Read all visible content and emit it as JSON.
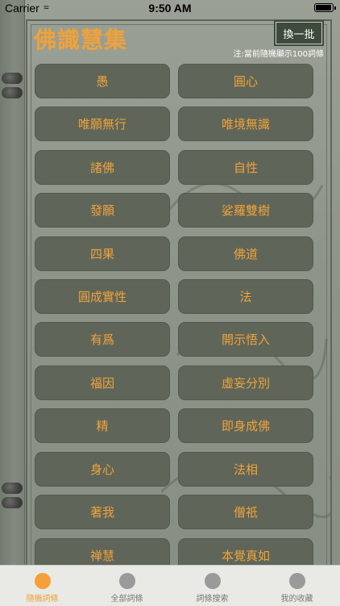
{
  "status_bar": {
    "carrier": "Carrier",
    "time": "9:50 AM"
  },
  "header": {
    "title": "佛識慧集",
    "refresh_label": "換一批",
    "note": "注:當前隨機顯示100詞條"
  },
  "words": [
    "愚",
    "圓心",
    "唯願無行",
    "唯境無識",
    "諸佛",
    "自性",
    "發願",
    "娑羅雙樹",
    "四果",
    "佛道",
    "圓成實性",
    "法",
    "有爲",
    "開示悟入",
    "福因",
    "虛妄分別",
    "精",
    "即身成佛",
    "身心",
    "法相",
    "著我",
    "僧祇",
    "禅慧",
    "本覺真如"
  ],
  "tabs": [
    {
      "label": "隨機詞條",
      "active": true,
      "icon": "circle-icon"
    },
    {
      "label": "全部詞條",
      "active": false,
      "icon": "circle-icon"
    },
    {
      "label": "詞條搜索",
      "active": false,
      "icon": "circle-icon"
    },
    {
      "label": "我的收藏",
      "active": false,
      "icon": "circle-icon"
    }
  ],
  "colors": {
    "accent": "#f0a23a",
    "button_bg": "#5f6659",
    "page_bg": "#8e958a"
  }
}
